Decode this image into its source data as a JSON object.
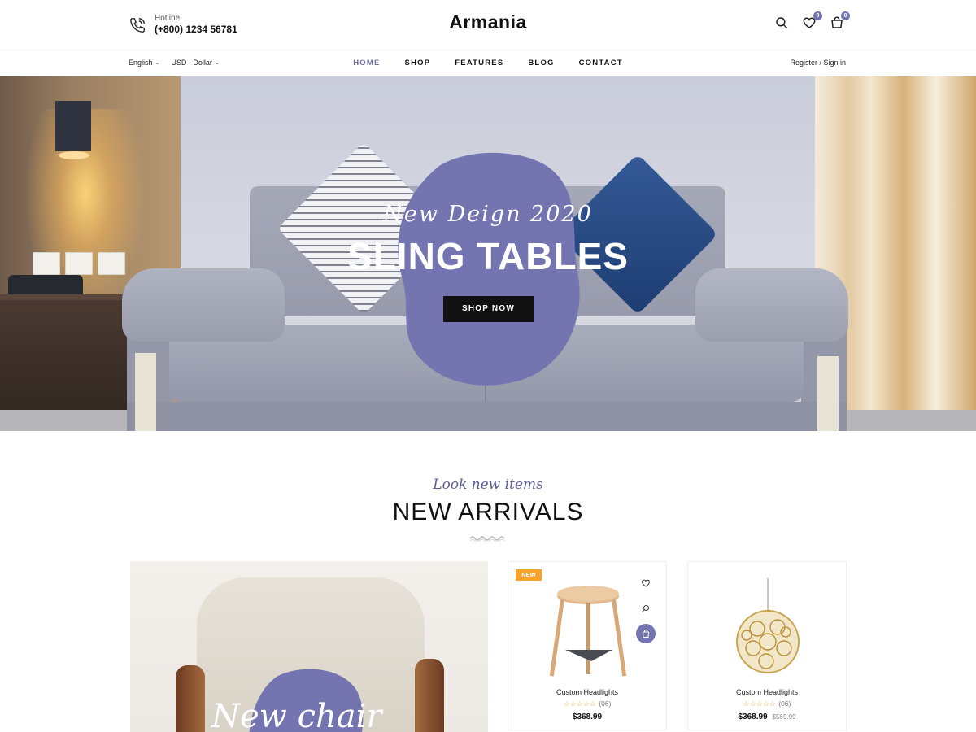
{
  "header": {
    "hotline_label": "Hotline:",
    "hotline_number": "(+800) 1234 56781",
    "logo": "Armania",
    "wishlist_count": "0",
    "cart_count": "0"
  },
  "nav": {
    "language": "English",
    "currency": "USD - Dollar",
    "items": [
      {
        "label": "HOME",
        "active": true
      },
      {
        "label": "SHOP",
        "active": false
      },
      {
        "label": "FEATURES",
        "active": false
      },
      {
        "label": "BLOG",
        "active": false
      },
      {
        "label": "CONTACT",
        "active": false
      }
    ],
    "account": "Register / Sign in"
  },
  "hero": {
    "script": "New Deign 2020",
    "title": "SLING TABLES",
    "button": "SHOP NOW"
  },
  "section": {
    "script": "Look new items",
    "title": "NEW ARRIVALS"
  },
  "feature": {
    "text": "New chair"
  },
  "products": [
    {
      "badge": "NEW",
      "name": "Custom Headlights",
      "rating_count": "(06)",
      "price": "$368.99",
      "old_price": ""
    },
    {
      "badge": "",
      "name": "Custom Headlights",
      "rating_count": "(06)",
      "price": "$368.99",
      "old_price": "$569.99"
    }
  ],
  "colors": {
    "accent": "#7474b0",
    "badge": "#f4a32c",
    "dark": "#111111"
  },
  "icons": [
    "phone-icon",
    "search-icon",
    "heart-icon",
    "cart-icon",
    "chevron-down-icon",
    "quickview-icon",
    "bag-icon"
  ]
}
